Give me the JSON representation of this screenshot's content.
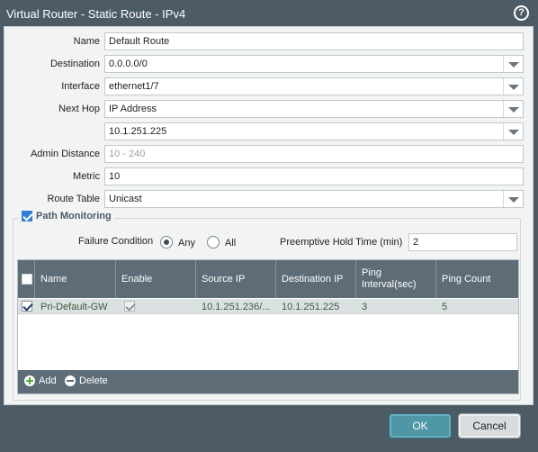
{
  "window": {
    "title": "Virtual Router - Static Route - IPv4",
    "help_icon": "?"
  },
  "form": {
    "name": {
      "label": "Name",
      "value": "Default Route"
    },
    "destination": {
      "label": "Destination",
      "value": "0.0.0.0/0"
    },
    "interface": {
      "label": "Interface",
      "value": "ethernet1/7"
    },
    "next_hop": {
      "label": "Next Hop",
      "value": "IP Address"
    },
    "next_hop_ip": {
      "value": "10.1.251.225"
    },
    "admin_distance": {
      "label": "Admin Distance",
      "placeholder": "10 - 240"
    },
    "metric": {
      "label": "Metric",
      "value": "10"
    },
    "route_table": {
      "label": "Route Table",
      "value": "Unicast"
    }
  },
  "path_monitoring": {
    "label": "Path Monitoring",
    "enabled": true,
    "failure_condition_label": "Failure Condition",
    "options": [
      "Any",
      "All"
    ],
    "selected": "Any",
    "hold_time_label": "Preemptive Hold Time (min)",
    "hold_time_value": "2",
    "table": {
      "columns": [
        "Name",
        "Enable",
        "Source IP",
        "Destination IP",
        "Ping Interval(sec)",
        "Ping Count"
      ],
      "rows": [
        {
          "name": "Pri-Default-GW",
          "enable": true,
          "source_ip": "10.1.251.236/...",
          "destination_ip": "10.1.251.225",
          "ping_interval": "3",
          "ping_count": "5",
          "checked": true
        }
      ],
      "add_label": "Add",
      "delete_label": "Delete"
    }
  },
  "buttons": {
    "ok": "OK",
    "cancel": "Cancel"
  },
  "colors": {
    "header": "#4d5b66",
    "ok_button": "#4f96a6",
    "check_blue": "#2f7fd8"
  }
}
